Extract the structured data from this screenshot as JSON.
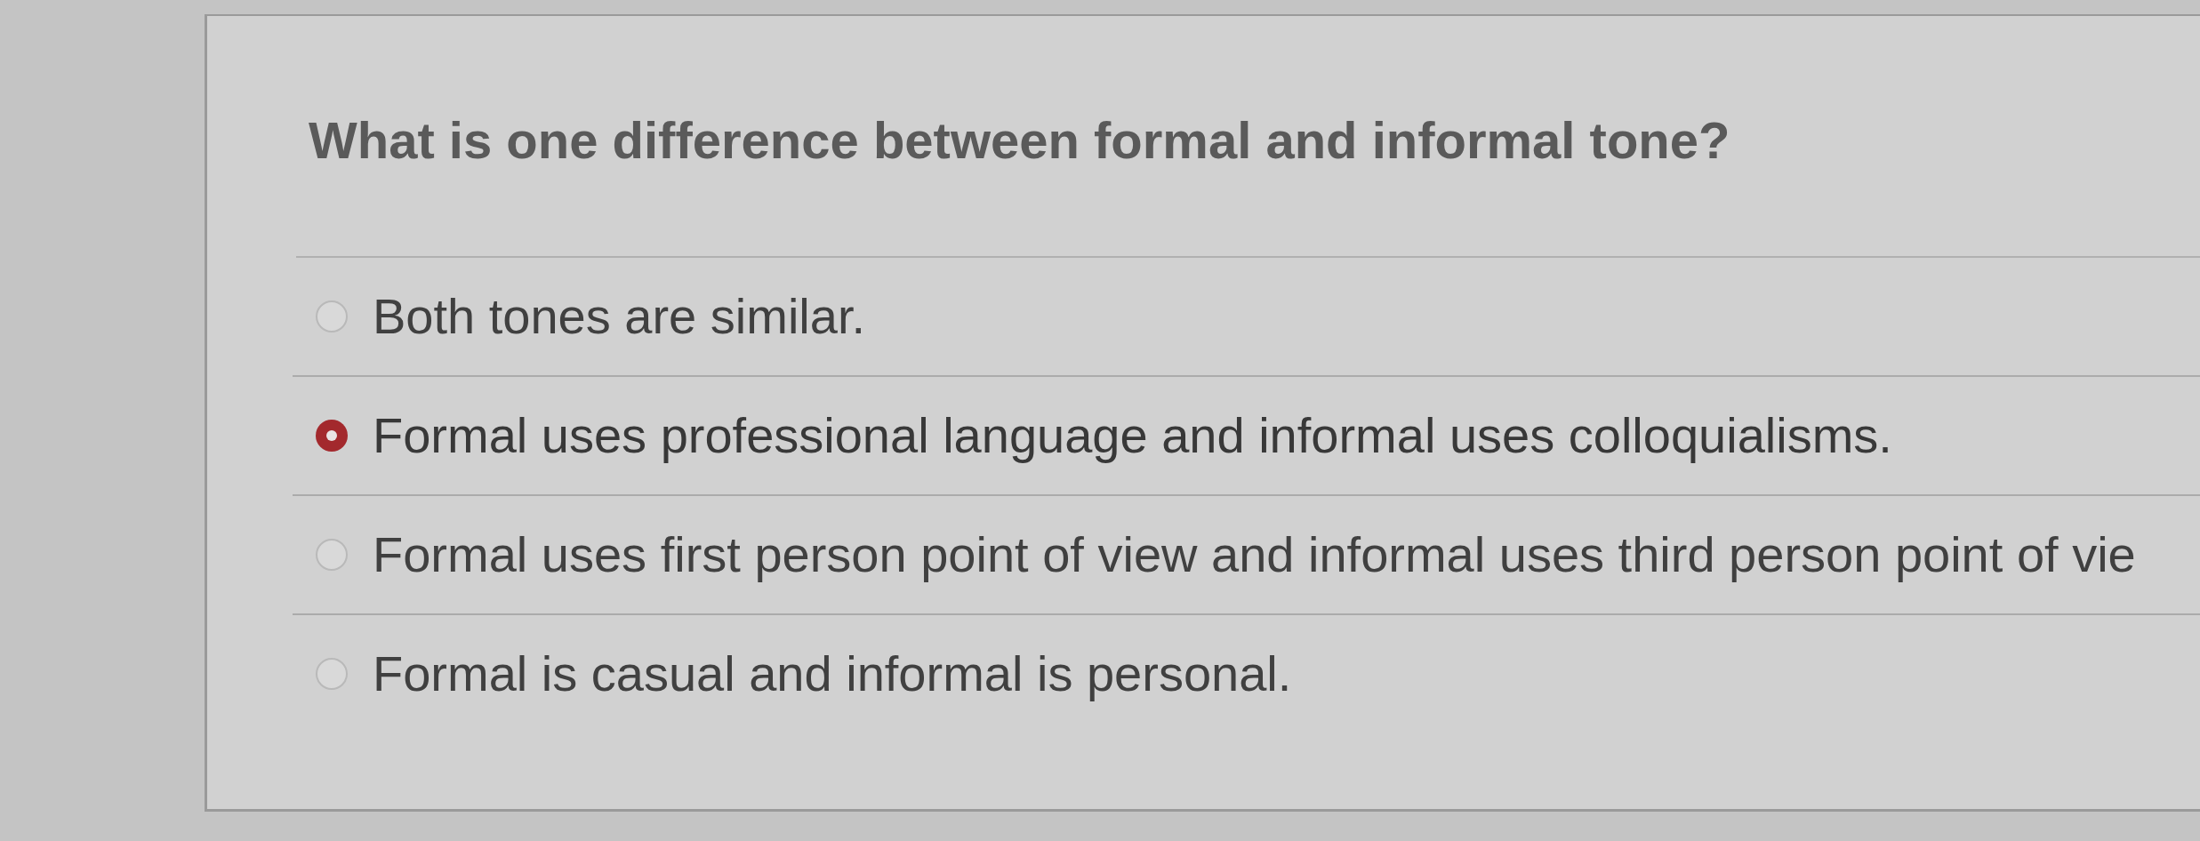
{
  "question": {
    "text": "What is one difference between formal and informal tone?"
  },
  "options": [
    {
      "label": "Both tones are similar.",
      "selected": false
    },
    {
      "label": "Formal uses professional language and informal uses colloquialisms.",
      "selected": true
    },
    {
      "label": "Formal uses first person point of view and informal uses third person point of vie",
      "selected": false
    },
    {
      "label": "Formal is casual and informal is personal.",
      "selected": false
    }
  ]
}
